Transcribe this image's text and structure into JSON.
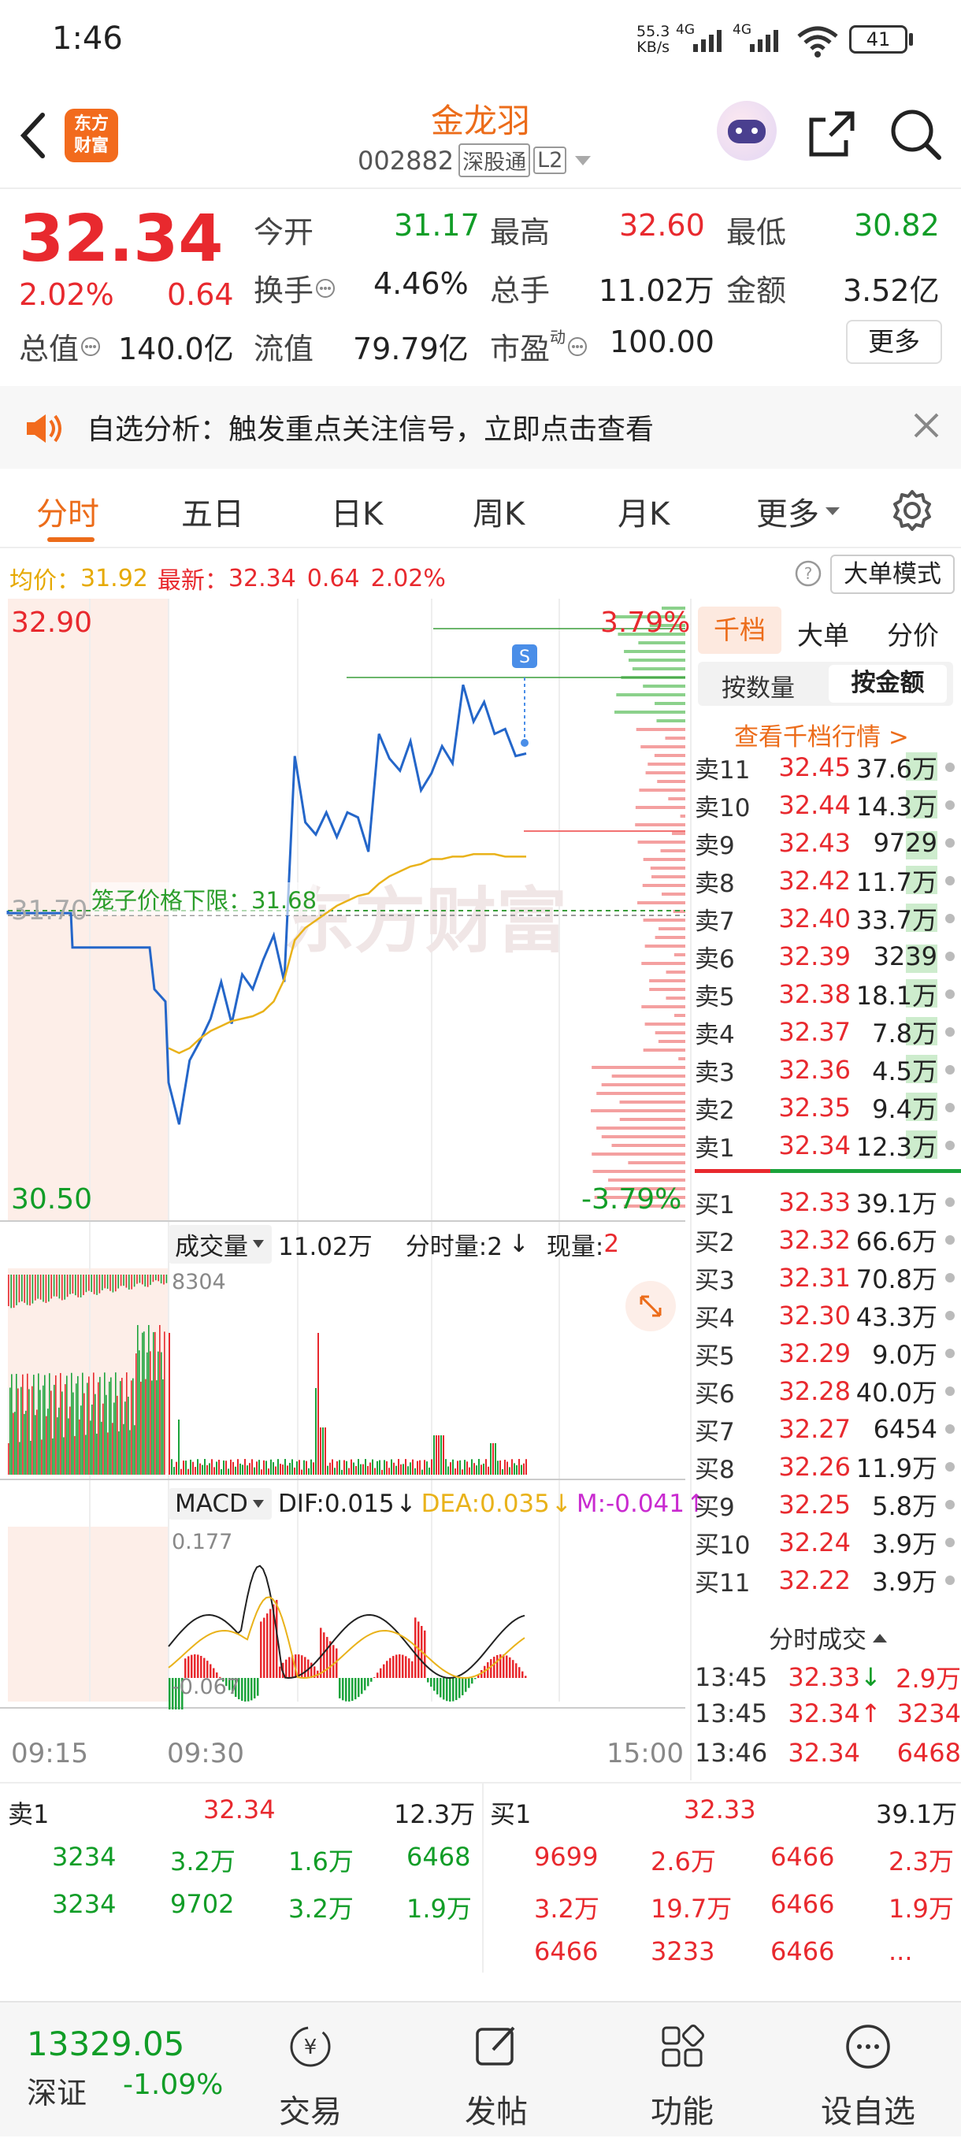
{
  "status": {
    "time": "1:46",
    "speed_num": "55.3",
    "speed_unit": "KB/s",
    "net1": "4G",
    "net2": "4G",
    "battery": "41"
  },
  "header": {
    "logo_line1": "东方",
    "logo_line2": "财富",
    "name": "金龙羽",
    "code": "002882",
    "tag1": "深股通",
    "tag2": "L2"
  },
  "quote": {
    "price": "32.34",
    "pct": "2.02%",
    "chg": "0.64",
    "open_label": "今开",
    "open": "31.17",
    "high_label": "最高",
    "high": "32.60",
    "low_label": "最低",
    "low": "30.82",
    "turnover_label": "换手",
    "turnover": "4.46%",
    "vol_label": "总手",
    "vol": "11.02万",
    "amount_label": "金额",
    "amount": "3.52亿",
    "mcap_label": "总值",
    "mcap": "140.0亿",
    "float_label": "流值",
    "float": "79.79亿",
    "pe_label": "市盈",
    "pe_sup": "动",
    "pe": "100.00",
    "more": "更多"
  },
  "notice": {
    "text": "自选分析：触发重点关注信号，立即点击查看"
  },
  "tabs": [
    "分时",
    "五日",
    "日K",
    "周K",
    "月K",
    "更多"
  ],
  "avgline": {
    "avg_label": "均价：",
    "avg": "31.92",
    "last_label": "最新：",
    "last": "32.34",
    "chg": "0.64",
    "pct": "2.02%",
    "mode": "大单模式"
  },
  "chart": {
    "price_top": "32.90",
    "price_mid": "31.70",
    "price_bottom": "30.50",
    "pct_top": "3.79%",
    "pct_bottom": "-3.79%",
    "cage_label": "笼子价格下限：31.68",
    "s_marker": "S",
    "watermark": "东方财富",
    "vol_sel": "成交量",
    "vol_total": "11.02万",
    "minute_vol": "分时量:2",
    "now_vol_label": "现量:",
    "now_vol": "2",
    "vol_max": "8304",
    "macd_sel": "MACD",
    "dif": "DIF:0.015",
    "dea": "DEA:0.035",
    "m": "M:-0.041",
    "macd_top": "0.177",
    "macd_bottom": "-0.067",
    "time_start": "09:15",
    "time_open": "09:30",
    "time_end": "15:00"
  },
  "chart_data": {
    "type": "line",
    "x": [
      "09:30",
      "09:35",
      "09:40",
      "09:45",
      "09:50",
      "09:55",
      "10:00",
      "10:05",
      "10:10",
      "10:15",
      "10:20",
      "10:25",
      "10:30",
      "10:35",
      "10:40",
      "10:45",
      "10:50",
      "10:55",
      "11:00",
      "11:05",
      "11:10",
      "11:15",
      "11:20",
      "11:25",
      "11:30",
      "13:05",
      "13:10",
      "13:15",
      "13:20",
      "13:25",
      "13:30",
      "13:35",
      "13:40",
      "13:45",
      "13:46"
    ],
    "series": [
      {
        "values": [
          31.0,
          30.83,
          31.09,
          31.17,
          31.26,
          31.41,
          31.24,
          31.44,
          31.38,
          31.5,
          31.6,
          31.41,
          32.33,
          32.06,
          32.01,
          32.1,
          32.0,
          32.1,
          32.08,
          31.94,
          32.42,
          32.32,
          32.27,
          32.39,
          32.19,
          32.26,
          32.37,
          32.3,
          32.62,
          32.47,
          32.55,
          32.42,
          32.44,
          32.33,
          32.34
        ]
      },
      {
        "values": [
          31.14,
          31.12,
          31.14,
          31.18,
          31.21,
          31.23,
          31.25,
          31.26,
          31.27,
          31.29,
          31.33,
          31.42,
          31.58,
          31.63,
          31.66,
          31.69,
          31.72,
          31.74,
          31.76,
          31.77,
          31.81,
          31.84,
          31.86,
          31.88,
          31.89,
          31.91,
          31.91,
          31.92,
          31.92,
          31.93,
          31.93,
          31.93,
          31.92,
          31.92,
          31.92
        ]
      }
    ],
    "ylim": [
      30.5,
      32.9
    ]
  },
  "orderbook": {
    "tabs": [
      "千档",
      "大单",
      "分价"
    ],
    "sub1": "按数量",
    "sub2": "按金额",
    "link": "查看千档行情 >",
    "asks": [
      {
        "label": "卖11",
        "price": "32.45",
        "vol": "37.6万"
      },
      {
        "label": "卖10",
        "price": "32.44",
        "vol": "14.3万"
      },
      {
        "label": "卖9",
        "price": "32.43",
        "vol": "9729"
      },
      {
        "label": "卖8",
        "price": "32.42",
        "vol": "11.7万"
      },
      {
        "label": "卖7",
        "price": "32.40",
        "vol": "33.7万"
      },
      {
        "label": "卖6",
        "price": "32.39",
        "vol": "3239"
      },
      {
        "label": "卖5",
        "price": "32.38",
        "vol": "18.1万"
      },
      {
        "label": "卖4",
        "price": "32.37",
        "vol": "7.8万"
      },
      {
        "label": "卖3",
        "price": "32.36",
        "vol": "4.5万"
      },
      {
        "label": "卖2",
        "price": "32.35",
        "vol": "9.4万"
      },
      {
        "label": "卖1",
        "price": "32.34",
        "vol": "12.3万"
      }
    ],
    "bids": [
      {
        "label": "买1",
        "price": "32.33",
        "vol": "39.1万"
      },
      {
        "label": "买2",
        "price": "32.32",
        "vol": "66.6万"
      },
      {
        "label": "买3",
        "price": "32.31",
        "vol": "70.8万"
      },
      {
        "label": "买4",
        "price": "32.30",
        "vol": "43.3万"
      },
      {
        "label": "买5",
        "price": "32.29",
        "vol": "9.0万"
      },
      {
        "label": "买6",
        "price": "32.28",
        "vol": "40.0万"
      },
      {
        "label": "买7",
        "price": "32.27",
        "vol": "6454"
      },
      {
        "label": "买8",
        "price": "32.26",
        "vol": "11.9万"
      },
      {
        "label": "买9",
        "price": "32.25",
        "vol": "5.8万"
      },
      {
        "label": "买10",
        "price": "32.24",
        "vol": "3.9万"
      },
      {
        "label": "买11",
        "price": "32.22",
        "vol": "3.9万"
      }
    ],
    "trades_title": "分时成交",
    "trades": [
      {
        "time": "13:45",
        "price": "32.33",
        "arrow": "↓",
        "vol": "2.9万"
      },
      {
        "time": "13:45",
        "price": "32.34",
        "arrow": "↑",
        "vol": "3234"
      },
      {
        "time": "13:46",
        "price": "32.34",
        "arrow": "",
        "vol": "6468"
      }
    ]
  },
  "bottom": {
    "sell_label": "卖1",
    "sell_price": "32.34",
    "sell_vol": "12.3万",
    "buy_label": "买1",
    "buy_price": "32.33",
    "buy_vol": "39.1万",
    "sell_rows": [
      [
        "3234",
        "3.2万",
        "1.6万",
        "6468"
      ],
      [
        "3234",
        "9702",
        "3.2万",
        "1.9万"
      ]
    ],
    "buy_rows": [
      [
        "9699",
        "2.6万",
        "6466",
        "2.3万"
      ],
      [
        "3.2万",
        "19.7万",
        "6466",
        "1.9万"
      ],
      [
        "6466",
        "3233",
        "6466",
        "..."
      ]
    ]
  },
  "footer": {
    "index_value": "13329.05",
    "index_name": "深证",
    "index_pct": "-1.09%",
    "btn1": "交易",
    "btn2": "发帖",
    "btn3": "功能",
    "btn4": "设自选"
  }
}
